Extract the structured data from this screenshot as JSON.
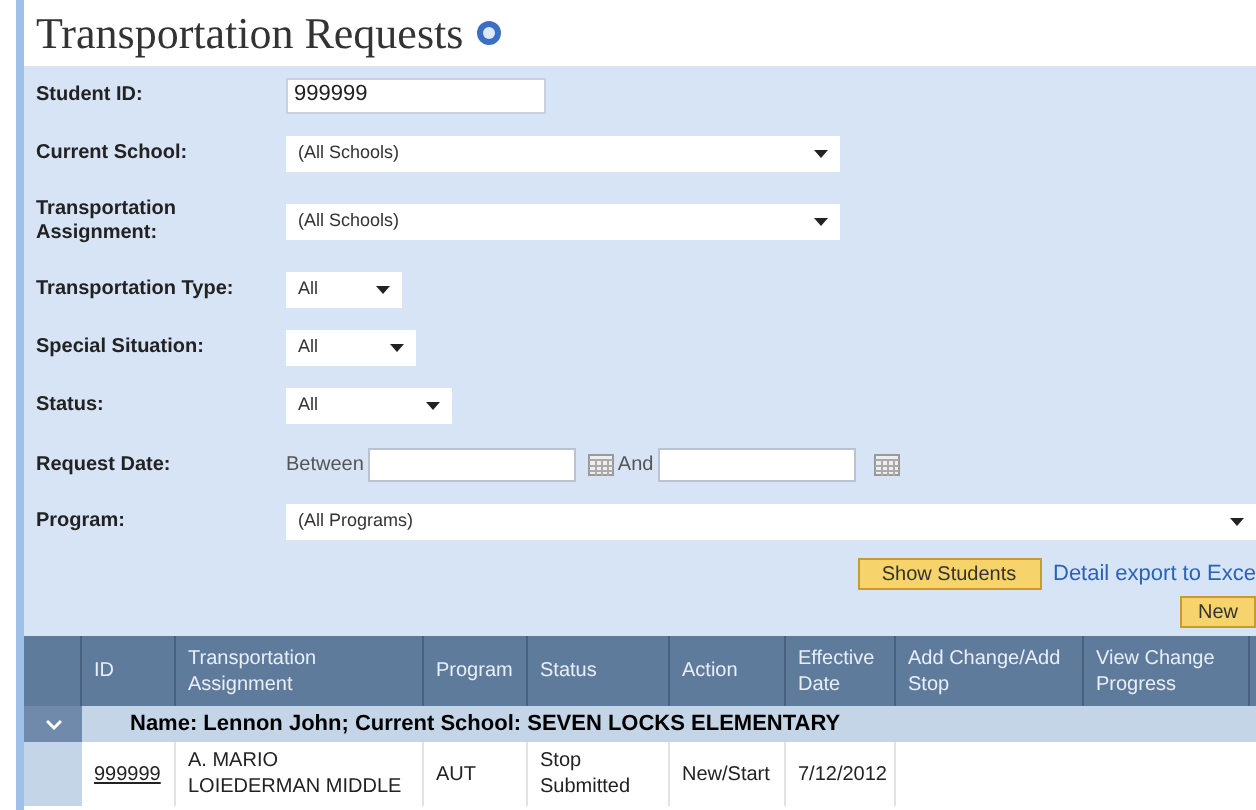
{
  "title": "Transportation Requests",
  "fields": [
    {
      "kind": "text",
      "label": "Student ID:",
      "value": "999999"
    },
    {
      "kind": "select",
      "label": "Current School:",
      "value": "(All Schools)"
    },
    {
      "kind": "select",
      "label": "Transportation Assignment:",
      "value": "(All Schools)"
    },
    {
      "kind": "select",
      "label": "Transportation Type:",
      "value": "All"
    },
    {
      "kind": "select",
      "label": "Special Situation:",
      "value": "All"
    },
    {
      "kind": "select",
      "label": "Status:",
      "value": "All"
    },
    {
      "kind": "daterange",
      "label": "Request Date:",
      "from_label": "Between",
      "to_label": "And"
    },
    {
      "kind": "select",
      "label": "Program:",
      "value": "(All Programs)"
    }
  ],
  "show_button": "Show Students",
  "export_link": "Detail export to Exce",
  "new_button": "New",
  "table": {
    "columns": [
      "ID",
      "Transportation Assignment",
      "Program",
      "Status",
      "Action",
      "Effective Date",
      "Add Change/Add Stop",
      "View Change Progress"
    ],
    "groups": [
      {
        "title": "Name: Lennon John; Current School: SEVEN LOCKS ELEMENTARY",
        "expanded": true,
        "rows": [
          [
            "999999",
            "A. MARIO LOIEDERMAN MIDDLE",
            "AUT",
            "Stop Submitted",
            "New/Start",
            "7/12/2012"
          ]
        ]
      }
    ]
  }
}
